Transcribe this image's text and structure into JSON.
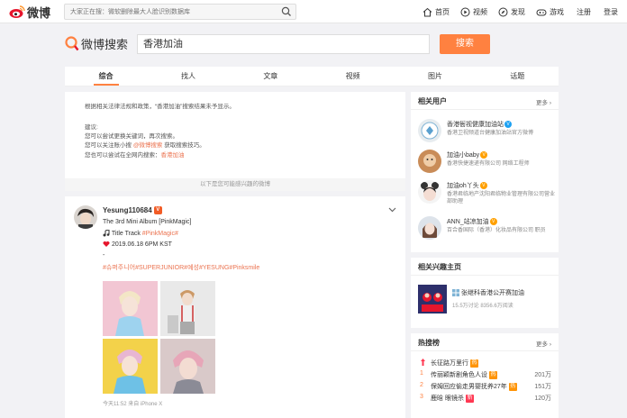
{
  "topnav": {
    "logo_text": "微博",
    "search_placeholder": "大家正在搜：微软删除最大人脸识别数据库",
    "items": [
      {
        "label": "首页",
        "icon": "home-icon"
      },
      {
        "label": "视频",
        "icon": "video-icon"
      },
      {
        "label": "发现",
        "icon": "discover-icon"
      },
      {
        "label": "游戏",
        "icon": "game-icon"
      }
    ],
    "login": "注册",
    "register": "登录"
  },
  "search": {
    "brand": "微博搜索",
    "query": "香港加油",
    "button": "搜索"
  },
  "tabs": [
    {
      "label": "综合",
      "active": true
    },
    {
      "label": "找人"
    },
    {
      "label": "文章"
    },
    {
      "label": "视频"
    },
    {
      "label": "图片"
    },
    {
      "label": "话题"
    }
  ],
  "notice": {
    "line1": "根据相关法律法规和政策，“香港加油”搜索结果未予显示。",
    "tip_title": "建议:",
    "tip1": "您可以尝试更换关键词，再次搜索。",
    "tip2_prefix": "您可以关注账小搜 ",
    "tip2_link": "@微博搜索",
    "tip2_suffix": " 获取搜索技巧。",
    "tip3_prefix": "您也可以尝试在全网内搜索：",
    "tip3_link": "香港加油",
    "footer": "以下是您可能感兴趣的微博"
  },
  "post": {
    "user": "Yesung110684",
    "badge": "V",
    "line1": "The 3rd Mini Album [PinkMagic]",
    "line2_prefix": "Title Track ",
    "line2_tag": "#PinkMagic#",
    "line3": "2019.06.18 6PM KST",
    "line4": "-",
    "tags": [
      "#슈퍼주니어",
      "#SUPERJUNIOR",
      "#예성",
      "#YESUNG",
      "#Pinksmile"
    ],
    "footer": "今天11:52 来自 iPhone X"
  },
  "side_users": {
    "title": "相关用户",
    "more": "更多",
    "items": [
      {
        "name": "香港衙视健康加油站",
        "badge": "V",
        "desc": "香港卫视频道台健康加油站官方微博"
      },
      {
        "name": "加油小baby",
        "badge": "V",
        "desc": "香港快捷速递有限公司 网络工程师"
      },
      {
        "name": "加油oh丫头",
        "badge": "V",
        "desc": "香港君临地产沈阳君临物业管理有限公司营业部助理"
      },
      {
        "name": "ANN_站凉加油",
        "badge": "V",
        "desc": "百合香国际（香港）化妆品有限公司 职员"
      }
    ]
  },
  "side_topic": {
    "title": "相关兴趣主页",
    "name": "张继科香港公开赛加油",
    "stats": "15.5万讨论 8356.6万阅读"
  },
  "side_hot": {
    "title": "热搜榜",
    "more": "更多",
    "items": [
      {
        "rank": "",
        "text": "长征路万里行",
        "tag": "热",
        "count": ""
      },
      {
        "rank": "1",
        "text": "传丽颖新剧角色人设",
        "tag": "热",
        "count": "201万"
      },
      {
        "rank": "2",
        "text": "保姆回应偷走男婴抚养27年",
        "tag": "热",
        "count": "151万"
      },
      {
        "rank": "3",
        "text": "鹿晗 眼镜杀",
        "tag": "新",
        "count": "120万"
      }
    ]
  },
  "colors": {
    "accent": "#ff8140",
    "link": "#eb7350",
    "verified_orange": "#f25c26",
    "verified_yellow": "#ffa000",
    "background": "#f2f2f5"
  }
}
